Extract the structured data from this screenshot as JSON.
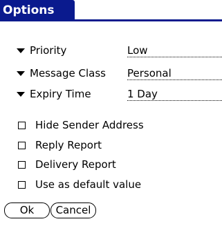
{
  "dialog": {
    "title": "Options"
  },
  "fields": [
    {
      "label": "Priority",
      "value": "Low"
    },
    {
      "label": "Message Class",
      "value": "Personal"
    },
    {
      "label": "Expiry Time",
      "value": "1 Day"
    }
  ],
  "checkboxes": [
    {
      "label": "Hide Sender Address",
      "checked": false
    },
    {
      "label": "Reply Report",
      "checked": false
    },
    {
      "label": "Delivery Report",
      "checked": false
    },
    {
      "label": "Use as default value",
      "checked": false
    }
  ],
  "buttons": {
    "ok": "Ok",
    "cancel": "Cancel"
  },
  "colors": {
    "title_bar": "#0a1a8e"
  }
}
